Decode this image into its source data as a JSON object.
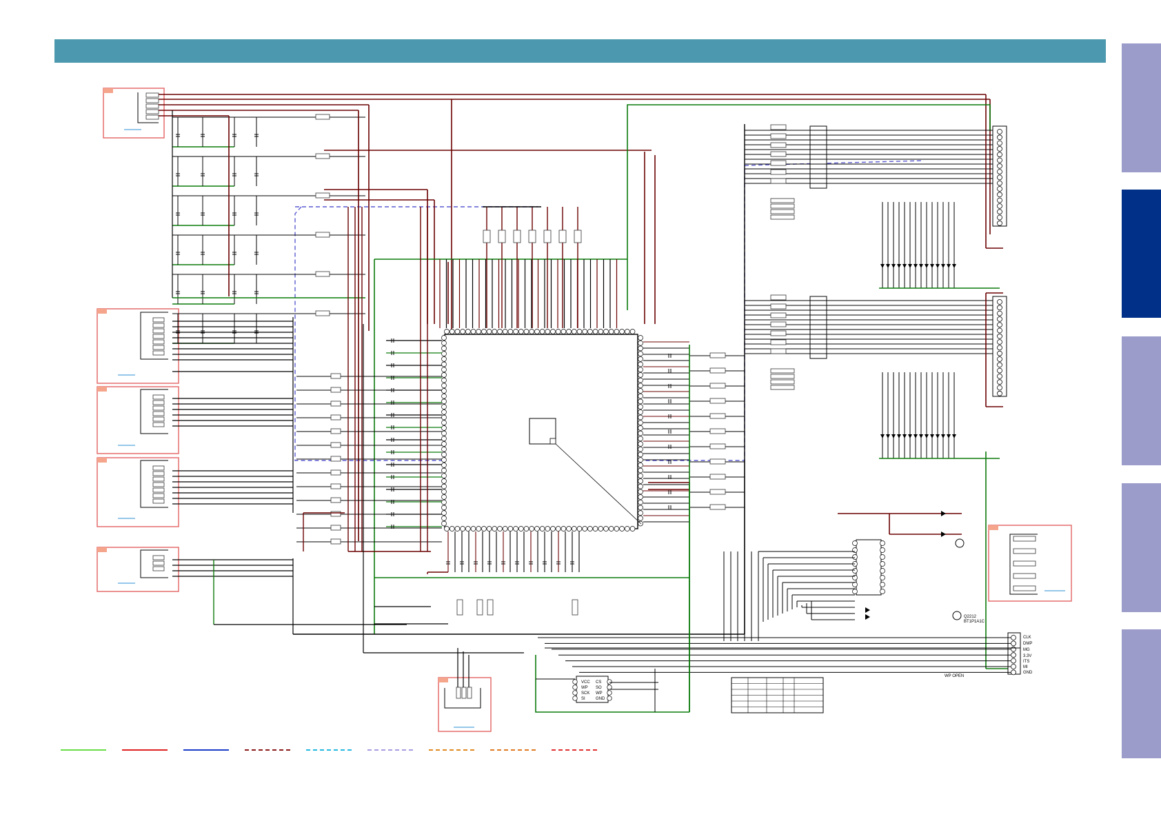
{
  "colors": {
    "header": "#4c98ae",
    "tab_inactive": "#9b9cc9",
    "tab_active": "#003087",
    "wire_dark_red": "#6b0000",
    "wire_green": "#0a7a0a",
    "wire_black": "#000000",
    "dashed_blue": "#5a5ad0",
    "connector_box": "#e56c6c",
    "connector_tag": "#f4a58c",
    "link_blue": "#2a8fd6"
  },
  "side_tabs": [
    {
      "state": "inactive"
    },
    {
      "state": "active"
    },
    {
      "state": "inactive"
    },
    {
      "state": "inactive"
    },
    {
      "state": "inactive"
    }
  ],
  "connector_pins": {
    "labels": [
      "CLK",
      "DMP",
      "MG",
      "3.3V",
      "ITS",
      "MI",
      "GND"
    ]
  },
  "transistor": {
    "labels": [
      "Q2212",
      "BT1P1A1C"
    ]
  },
  "eeprom_pins": {
    "left": [
      "VCC",
      "WP",
      "SCK",
      "SI"
    ],
    "right": [
      "CS",
      "SO",
      "WP",
      "GND"
    ]
  },
  "wp_label": "WP OPEN",
  "legend": [
    {
      "color": "#66dd44",
      "style": "solid"
    },
    {
      "color": "#e02020",
      "style": "solid"
    },
    {
      "color": "#1a3cc8",
      "style": "solid"
    },
    {
      "color": "#8b1a1a",
      "style": "dashed"
    },
    {
      "color": "#22b8e0",
      "style": "dashed"
    },
    {
      "color": "#a89be0",
      "style": "dashed"
    },
    {
      "color": "#e08a20",
      "style": "dashed"
    },
    {
      "color": "#e07a20",
      "style": "dashed"
    },
    {
      "color": "#e03030",
      "style": "dashed"
    }
  ]
}
